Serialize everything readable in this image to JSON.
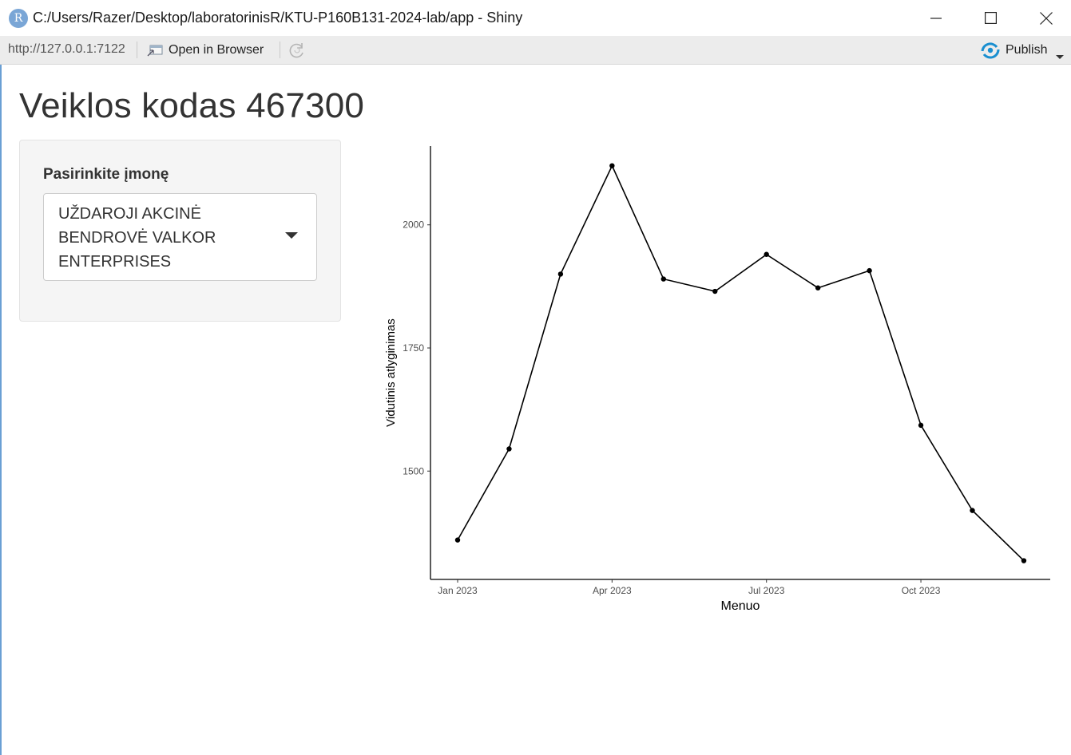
{
  "window": {
    "title": "C:/Users/Razer/Desktop/laboratorinisR/KTU-P160B131-2024-lab/app - Shiny",
    "icon_letter": "R"
  },
  "toolbar": {
    "url": "http://127.0.0.1:7122",
    "open_label": "Open in Browser",
    "publish_label": "Publish"
  },
  "page": {
    "title": "Veiklos kodas 467300",
    "select_label": "Pasirinkite įmonę",
    "select_value": "UŽDAROJI AKCINĖ BENDROVĖ VALKOR ENTERPRISES"
  },
  "colors": {
    "accent": "#1a8fd0",
    "line": "#000000"
  },
  "chart_data": {
    "type": "line",
    "xlabel": "Menuo",
    "ylabel": "Vidutinis atlyginimas",
    "x": [
      "2023-01",
      "2023-02",
      "2023-03",
      "2023-04",
      "2023-05",
      "2023-06",
      "2023-07",
      "2023-08",
      "2023-09",
      "2023-10",
      "2023-11",
      "2023-12"
    ],
    "values": [
      1360,
      1545,
      1900,
      2120,
      1890,
      1865,
      1940,
      1872,
      1907,
      1593,
      1420,
      1318
    ],
    "x_ticks": [
      "Jan 2023",
      "Apr 2023",
      "Jul 2023",
      "Oct 2023"
    ],
    "y_ticks": [
      1500,
      1750,
      2000
    ],
    "ylim": [
      1280,
      2160
    ],
    "grid": false
  }
}
